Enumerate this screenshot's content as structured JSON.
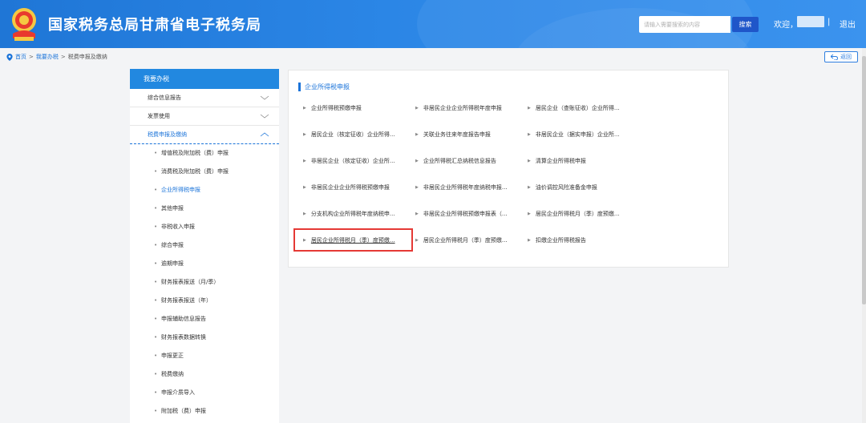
{
  "header": {
    "site_title": "国家税务总局甘肃省电子税务局",
    "search_placeholder": "请输入需要搜索的内容",
    "search_button": "搜索",
    "welcome": "欢迎，",
    "separator": "|",
    "logout": "退出"
  },
  "breadcrumb": {
    "home": "首页",
    "arrow": ">",
    "level1": "我要办税",
    "level2": "税费申报及缴纳",
    "back": "返回"
  },
  "sidebar": {
    "header": "我要办税",
    "groups": [
      {
        "label": "综合信息报告",
        "expanded": false
      },
      {
        "label": "发票使用",
        "expanded": false
      },
      {
        "label": "税费申报及缴纳",
        "expanded": true
      }
    ],
    "bullet": "•",
    "sub_items": [
      "增值税及附加税（费）申报",
      "消费税及附加税（费）申报",
      "企业所得税申报",
      "其他申报",
      "非税收入申报",
      "综合申报",
      "逾期申报",
      "财务报表报送（月/季）",
      "财务报表报送（年）",
      "申报辅助信息报告",
      "财务报表数据转换",
      "申报更正",
      "税费缴纳",
      "申报介质导入",
      "附加税（费）申报"
    ],
    "active_sub_index": 2
  },
  "panel": {
    "title": "企业所得税申报",
    "tri": "▶",
    "items": [
      [
        "企业所得税预缴申报",
        "非居民企业企业所得税年度申报",
        "居民企业（查账征收）企业所得..."
      ],
      [
        "居民企业（核定征收）企业所得...",
        "关联业务往来年度报告申报",
        "非居民企业（据实申报）企业所..."
      ],
      [
        "非居民企业（核定征收）企业所...",
        "企业所得税汇总纳税信息报告",
        "清算企业所得税申报"
      ],
      [
        "非居民企业企业所得税预缴申报",
        "非居民企业所得税年度纳税申报...",
        "油价调控风险准备金申报"
      ],
      [
        "分支机构企业所得税年度纳税申...",
        "非居民企业所得税预缴申报表（...",
        "居民企业所得税月（季）度预缴..."
      ],
      [
        "居民企业所得税月（季）度预缴...",
        "居民企业所得税月（季）度预缴...",
        "扣缴企业所得税报告"
      ]
    ]
  },
  "colors": {
    "header_blue": "#2b86e6",
    "accent": "#1a73d9",
    "highlight_red": "#e53935"
  }
}
